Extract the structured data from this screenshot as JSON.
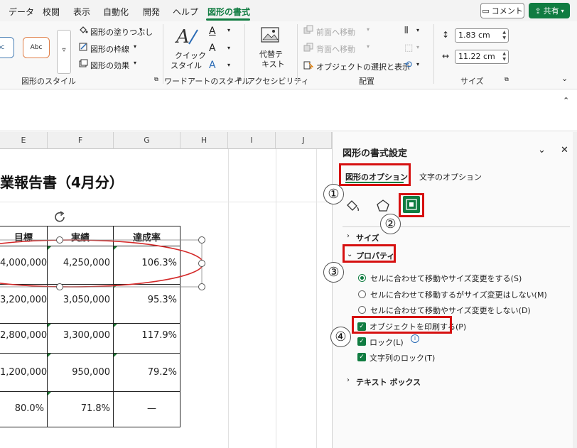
{
  "menu": {
    "items": [
      "データ",
      "校閲",
      "表示",
      "自動化",
      "開発",
      "ヘルプ",
      "図形の書式"
    ],
    "comment_label": "コメント",
    "share_label": "共有"
  },
  "ribbon": {
    "style_samples": [
      "bc",
      "Abc"
    ],
    "fill_label": "図形の塗りつぶし",
    "outline_label": "図形の枠線",
    "effects_label": "図形の効果",
    "shape_styles_group": "図形のスタイル",
    "quick_style_line1": "クイック",
    "quick_style_line2": "スタイル",
    "wordart_group": "ワードアートのスタイル",
    "alt_text_line1": "代替テ",
    "alt_text_line2": "キスト",
    "accessibility_group": "アクセシビリティ",
    "bring_forward_label": "前面へ移動",
    "send_backward_label": "背面へ移動",
    "selection_pane_label": "オブジェクトの選択と表示",
    "arrange_group": "配置",
    "height_value": "1.83 cm",
    "width_value": "11.22 cm",
    "size_group": "サイズ"
  },
  "sheet": {
    "columns": [
      "E",
      "F",
      "G",
      "H",
      "I",
      "J"
    ],
    "title": "業報告書（4月分）",
    "headers": [
      "目標",
      "実績",
      "達成率"
    ],
    "rows": [
      [
        "4,000,000",
        "4,250,000",
        "106.3%"
      ],
      [
        "3,200,000",
        "3,050,000",
        "95.3%"
      ],
      [
        "2,800,000",
        "3,300,000",
        "117.9%"
      ],
      [
        "1,200,000",
        "950,000",
        "79.2%"
      ],
      [
        "80.0%",
        "71.8%",
        "—"
      ]
    ]
  },
  "pane": {
    "title": "図形の書式設定",
    "tab_shape": "図形のオプション",
    "tab_text": "文字のオプション",
    "section_size": "サイズ",
    "section_properties": "プロパティ",
    "radio_options": [
      "セルに合わせて移動やサイズ変更をする(S)",
      "セルに合わせて移動するがサイズ変更はしない(M)",
      "セルに合わせて移動やサイズ変更をしない(D)"
    ],
    "print_object_label": "オブジェクトを印刷する(P)",
    "lock_label": "ロック(L)",
    "lock_text_label": "文字列のロック(T)",
    "section_textbox": "テキスト ボックス",
    "callouts": [
      "①",
      "②",
      "③",
      "④"
    ]
  },
  "colors": {
    "accent": "#107c41",
    "highlight": "#d61010",
    "ellipse": "#d42a2a"
  }
}
